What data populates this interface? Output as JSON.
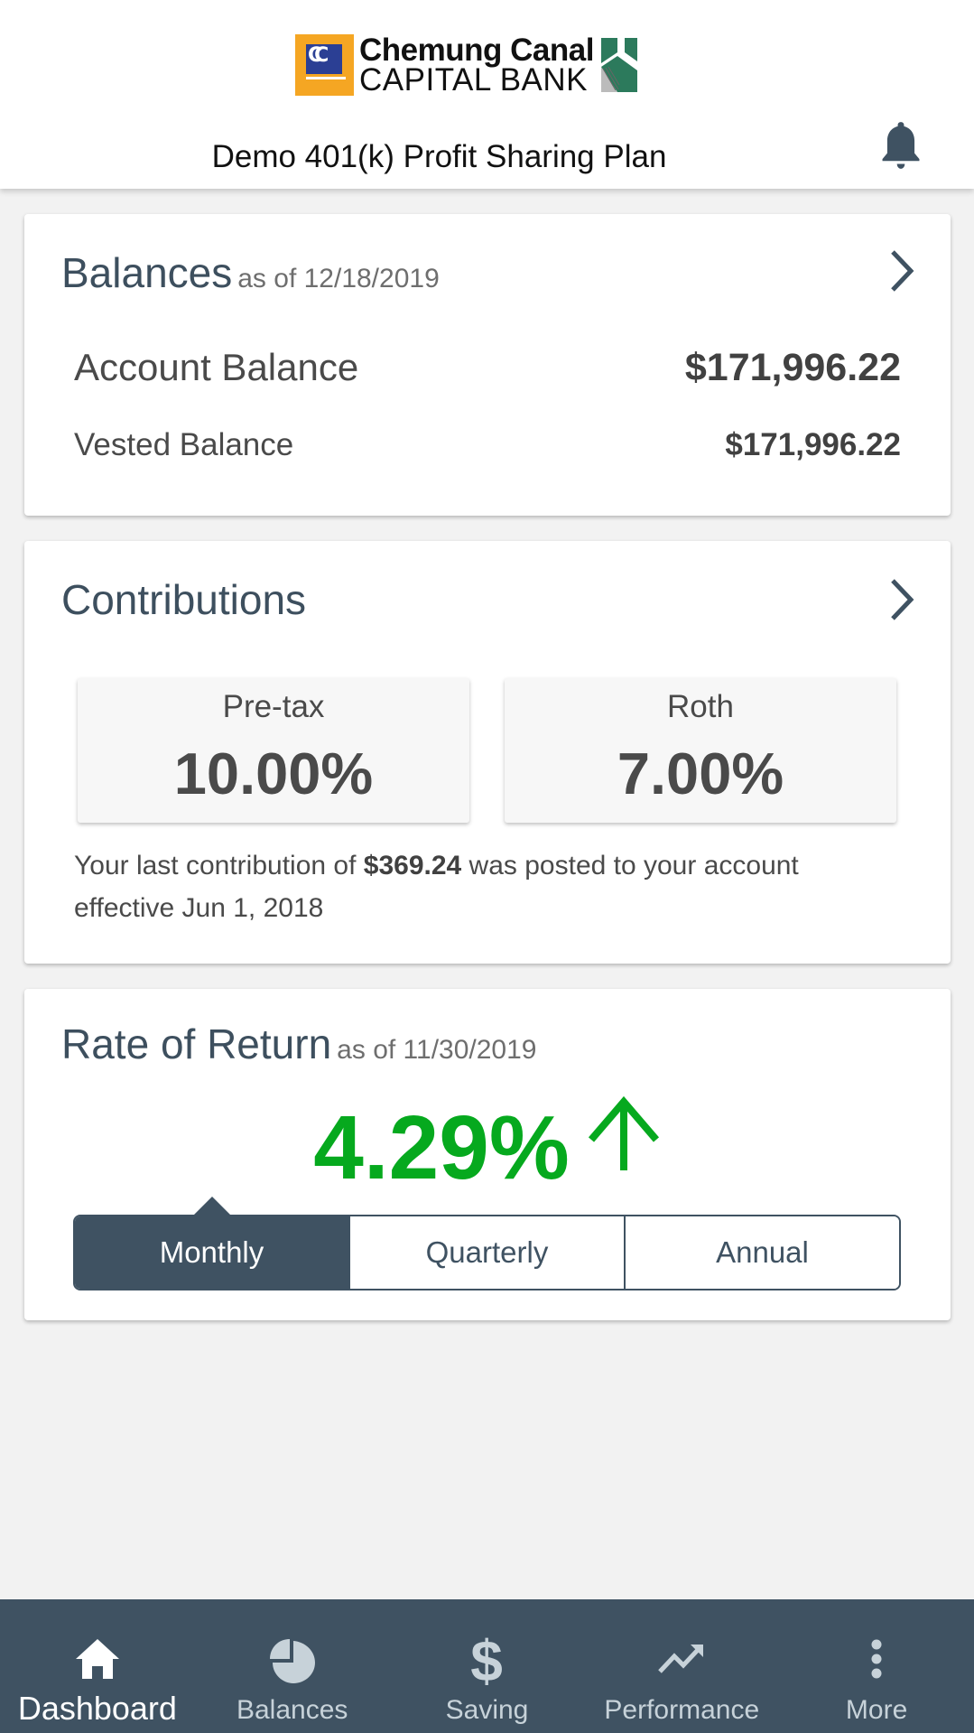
{
  "header": {
    "brand_line1": "Chemung Canal",
    "brand_line2": "CAPITAL BANK",
    "plan_title": "Demo 401(k) Profit Sharing Plan",
    "notification_icon": "bell-icon"
  },
  "balances": {
    "title": "Balances",
    "as_of": "as of 12/18/2019",
    "account_balance_label": "Account Balance",
    "account_balance_value": "$171,996.22",
    "vested_balance_label": "Vested Balance",
    "vested_balance_value": "$171,996.22"
  },
  "contributions": {
    "title": "Contributions",
    "items": [
      {
        "label": "Pre-tax",
        "value": "10.00%"
      },
      {
        "label": "Roth",
        "value": "7.00%"
      }
    ],
    "note_prefix": "Your last contribution of ",
    "note_amount": "$369.24",
    "note_suffix": " was posted to your account effective Jun 1, 2018"
  },
  "rate_of_return": {
    "title": "Rate of Return",
    "as_of": "as of 11/30/2019",
    "value": "4.29%",
    "trend": "up",
    "trend_color": "#06a91e",
    "periods": [
      "Monthly",
      "Quarterly",
      "Annual"
    ],
    "selected_period": "Monthly"
  },
  "tabbar": {
    "items": [
      {
        "label": "Dashboard",
        "icon": "home-icon",
        "active": true
      },
      {
        "label": "Balances",
        "icon": "pie-chart-icon",
        "active": false
      },
      {
        "label": "Saving",
        "icon": "dollar-icon",
        "active": false
      },
      {
        "label": "Performance",
        "icon": "trending-up-icon",
        "active": false
      },
      {
        "label": "More",
        "icon": "more-vertical-icon",
        "active": false
      }
    ]
  },
  "colors": {
    "primary": "#3f5262",
    "positive": "#06a91e",
    "background": "#f2f2f2"
  }
}
